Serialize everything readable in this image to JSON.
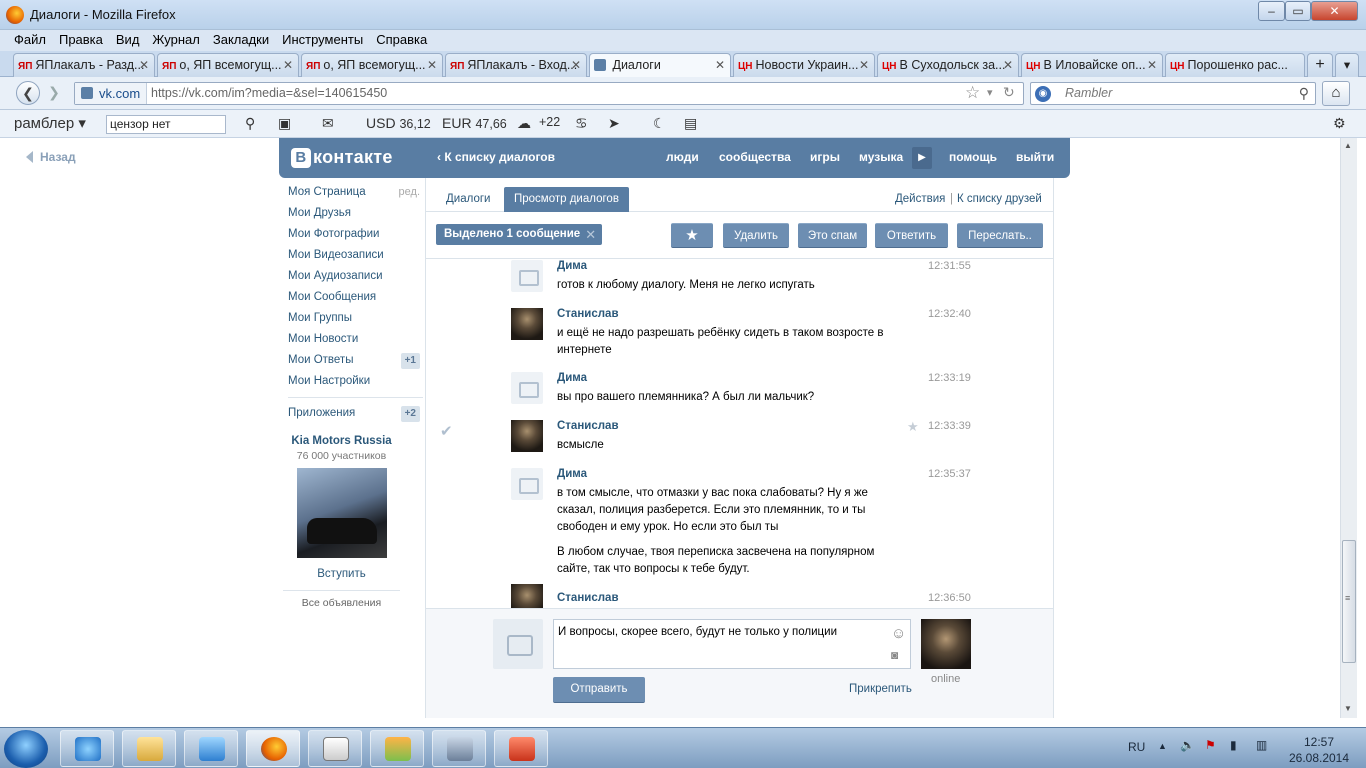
{
  "window": {
    "title": "Диалоги - Mozilla Firefox",
    "minimize": "‒",
    "maximize": "▭",
    "close": "✕"
  },
  "menu": [
    "Файл",
    "Правка",
    "Вид",
    "Журнал",
    "Закладки",
    "Инструменты",
    "Справка"
  ],
  "tabs": [
    {
      "badge": "ЯП",
      "label": "ЯПлакалъ - Разд..."
    },
    {
      "badge": "ЯП",
      "label": "о, ЯП всемогущ..."
    },
    {
      "badge": "ЯП",
      "label": "о, ЯП всемогущ..."
    },
    {
      "badge": "ЯП",
      "label": "ЯПлакалъ - Вход..."
    },
    {
      "badge": "",
      "label": "Диалоги"
    },
    {
      "badge": "ЦН",
      "label": "Новости Украин..."
    },
    {
      "badge": "ЦН",
      "label": "В Суходольск за..."
    },
    {
      "badge": "ЦН",
      "label": "В Иловайске оп..."
    },
    {
      "badge": "ЦН",
      "label": "Порошенко рас..."
    }
  ],
  "tab_close": "✕",
  "new_tab": "+",
  "tab_list": "▾",
  "nav": {
    "back": "❮",
    "forward": "❯",
    "site": "vk.com",
    "url": "https://vk.com/im?media=&sel=140615450",
    "star": "☆",
    "dropdown": "▾",
    "reload": "↻",
    "search_engine_icon": "◉",
    "search_placeholder": "Rambler",
    "search_btn": "⚲",
    "home": "⌂"
  },
  "rambler": {
    "brand": "рамблер ▾",
    "query": "цензор нет",
    "search": "⚲",
    "usd_label": "USD",
    "usd": "36,12",
    "eur_label": "EUR",
    "eur": "47,66",
    "temp": "+22",
    "weather_icon": "☁",
    "zodiac_icon": "♋",
    "mail_icon": "✉",
    "send_icon": "➤",
    "moon_icon": "☾",
    "news_icon": "▤",
    "doc_icon": "▣",
    "settings_icon": "⚙"
  },
  "back_link": "Назад",
  "vk": {
    "logo_letter": "В",
    "logo_text": "контакте",
    "to_list": "К списку диалогов",
    "nav": [
      "люди",
      "сообщества",
      "игры",
      "музыка",
      "помощь",
      "выйти"
    ],
    "play": "▶"
  },
  "left_menu": [
    {
      "label": "Моя Страница",
      "extra": "ред."
    },
    {
      "label": "Мои Друзья",
      "extra": ""
    },
    {
      "label": "Мои Фотографии",
      "extra": ""
    },
    {
      "label": "Мои Видеозаписи",
      "extra": ""
    },
    {
      "label": "Мои Аудиозаписи",
      "extra": ""
    },
    {
      "label": "Мои Сообщения",
      "extra": ""
    },
    {
      "label": "Мои Группы",
      "extra": ""
    },
    {
      "label": "Мои Новости",
      "extra": ""
    },
    {
      "label": "Мои Ответы",
      "extra": "+1"
    },
    {
      "label": "Мои Настройки",
      "extra": ""
    }
  ],
  "apps": {
    "label": "Приложения",
    "count": "+2"
  },
  "ad": {
    "name": "Kia Motors Russia",
    "members": "76 000 участников",
    "join": "Вступить",
    "all_ads": "Все объявления"
  },
  "dialog_tabs": {
    "dialogs": "Диалоги",
    "view": "Просмотр диалогов",
    "actions": "Действия",
    "sep": "|",
    "to_friends": "К списку друзей"
  },
  "toolbar": {
    "selected": "Выделено 1 сообщение",
    "clear": "✕",
    "star": "★",
    "delete": "Удалить",
    "spam": "Это спам",
    "reply": "Ответить",
    "forward": "Переслать.."
  },
  "messages": [
    {
      "author": "Дима",
      "avatar": "camera",
      "time": "12:31:55",
      "text": "готов к любому диалогу. Меня не легко испугать",
      "text2": "",
      "checked": false,
      "star": false
    },
    {
      "author": "Станислав",
      "avatar": "photo",
      "time": "12:32:40",
      "text": "и ещё не надо разрешать ребёнку сидеть в таком возросте в интернете",
      "text2": "",
      "checked": false,
      "star": false
    },
    {
      "author": "Дима",
      "avatar": "camera",
      "time": "12:33:19",
      "text": "вы про вашего племянника? А был ли мальчик?",
      "text2": "",
      "checked": false,
      "star": false
    },
    {
      "author": "Станислав",
      "avatar": "photo",
      "time": "12:33:39",
      "text": "всмысле",
      "text2": "",
      "checked": true,
      "star": true
    },
    {
      "author": "Дима",
      "avatar": "camera",
      "time": "12:35:37",
      "text": "в том смысле, что отмазки у вас пока слабоваты? Ну я же сказал, полиция разберется. Если это племянник, то и ты свободен и ему урок. Но если это был ты",
      "text2": "В любом случае, твоя переписка засвечена на популярном сайте, так что вопросы к тебе будут.",
      "checked": false,
      "star": false
    },
    {
      "author": "Станислав",
      "avatar": "photo",
      "time": "12:36:50",
      "text": "",
      "text2": "",
      "checked": false,
      "star": false
    }
  ],
  "msg_icons": {
    "check": "✔",
    "star": "★"
  },
  "composer": {
    "text": "И вопросы, скорее всего, будут не только у полиции",
    "emoji": "☺",
    "camera": "◙",
    "send": "Отправить",
    "attach": "Прикрепить",
    "status": "online"
  },
  "scroll": {
    "up": "▲",
    "down": "▼",
    "grip": "≡"
  },
  "tray": {
    "lang": "RU",
    "arrow": "▲",
    "volume": "🔈",
    "flag": "⚑",
    "battery": "▮",
    "network": "▥",
    "time": "12:57",
    "date": "26.08.2014"
  },
  "colors": {
    "vk_blue": "#597da3",
    "link": "#2b587a",
    "button": "#6d8eb2"
  }
}
